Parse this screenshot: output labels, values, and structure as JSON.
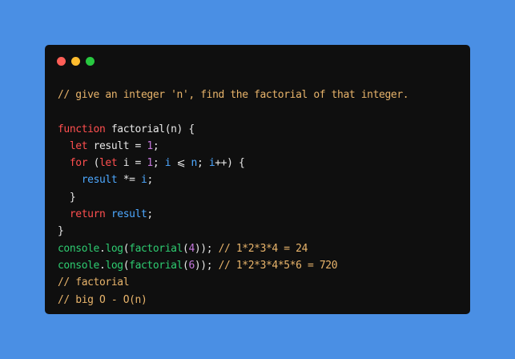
{
  "window": {
    "controls": [
      "close",
      "minimize",
      "maximize"
    ]
  },
  "code": {
    "lines": [
      [
        {
          "t": "// give an integer 'n', find the factorial of that integer.",
          "c": "comment"
        }
      ],
      [],
      [
        {
          "t": "function",
          "c": "kw"
        },
        {
          "t": " factorial(n) {",
          "c": "plain"
        }
      ],
      [
        {
          "t": "  ",
          "c": "plain"
        },
        {
          "t": "let",
          "c": "kw"
        },
        {
          "t": " result = ",
          "c": "plain"
        },
        {
          "t": "1",
          "c": "num"
        },
        {
          "t": ";",
          "c": "plain"
        }
      ],
      [
        {
          "t": "  ",
          "c": "plain"
        },
        {
          "t": "for",
          "c": "kw"
        },
        {
          "t": " (",
          "c": "plain"
        },
        {
          "t": "let",
          "c": "kw"
        },
        {
          "t": " i = ",
          "c": "plain"
        },
        {
          "t": "1",
          "c": "num"
        },
        {
          "t": "; ",
          "c": "plain"
        },
        {
          "t": "i",
          "c": "blue"
        },
        {
          "t": " ⩽ ",
          "c": "plain"
        },
        {
          "t": "n",
          "c": "blue"
        },
        {
          "t": "; ",
          "c": "plain"
        },
        {
          "t": "i",
          "c": "blue"
        },
        {
          "t": "++) {",
          "c": "plain"
        }
      ],
      [
        {
          "t": "    ",
          "c": "plain"
        },
        {
          "t": "result",
          "c": "blue"
        },
        {
          "t": " *= ",
          "c": "plain"
        },
        {
          "t": "i",
          "c": "blue"
        },
        {
          "t": ";",
          "c": "plain"
        }
      ],
      [
        {
          "t": "  }",
          "c": "plain"
        }
      ],
      [
        {
          "t": "  ",
          "c": "plain"
        },
        {
          "t": "return",
          "c": "kw"
        },
        {
          "t": " ",
          "c": "plain"
        },
        {
          "t": "result",
          "c": "blue"
        },
        {
          "t": ";",
          "c": "plain"
        }
      ],
      [
        {
          "t": "}",
          "c": "plain"
        }
      ],
      [
        {
          "t": "console",
          "c": "green"
        },
        {
          "t": ".",
          "c": "plain"
        },
        {
          "t": "log",
          "c": "green"
        },
        {
          "t": "(",
          "c": "plain"
        },
        {
          "t": "factorial",
          "c": "green"
        },
        {
          "t": "(",
          "c": "plain"
        },
        {
          "t": "4",
          "c": "num"
        },
        {
          "t": ")); ",
          "c": "plain"
        },
        {
          "t": "// 1*2*3*4 = 24",
          "c": "comment"
        }
      ],
      [
        {
          "t": "console",
          "c": "green"
        },
        {
          "t": ".",
          "c": "plain"
        },
        {
          "t": "log",
          "c": "green"
        },
        {
          "t": "(",
          "c": "plain"
        },
        {
          "t": "factorial",
          "c": "green"
        },
        {
          "t": "(",
          "c": "plain"
        },
        {
          "t": "6",
          "c": "num"
        },
        {
          "t": ")); ",
          "c": "plain"
        },
        {
          "t": "// 1*2*3*4*5*6 = 720",
          "c": "comment"
        }
      ],
      [
        {
          "t": "// factorial",
          "c": "comment"
        }
      ],
      [
        {
          "t": "// big O - O(n)",
          "c": "comment"
        }
      ]
    ]
  },
  "colors": {
    "background": "#4a8fe4",
    "window": "#0f0f0f",
    "comment": "#e8b46b",
    "keyword": "#ff4f4f",
    "number": "#c678dd",
    "identifier": "#4da8ff",
    "builtin": "#2ecc71"
  }
}
